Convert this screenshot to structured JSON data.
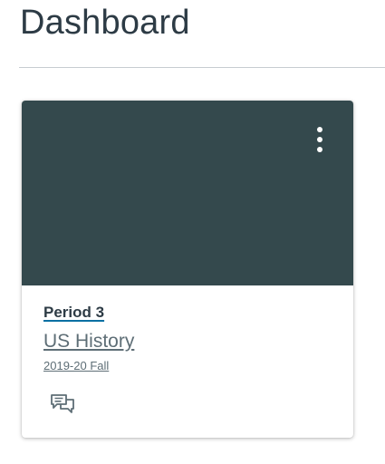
{
  "header": {
    "title": "Dashboard"
  },
  "course_card": {
    "hero_color": "#34494d",
    "nickname": "Period 3",
    "name": "US History",
    "term": "2019-20 Fall",
    "menu_icon": "kebab-menu-icon",
    "action_icon": "discussions-icon"
  }
}
